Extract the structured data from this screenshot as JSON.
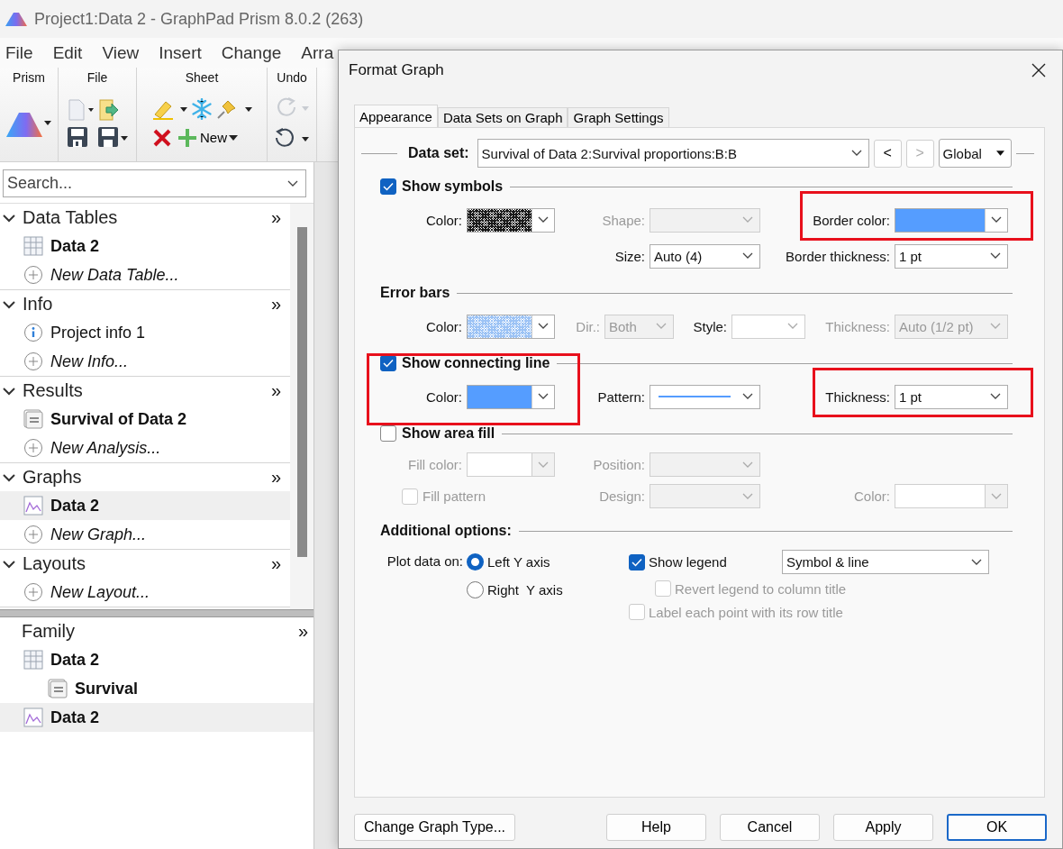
{
  "window": {
    "title": "Project1:Data 2 - GraphPad Prism 8.0.2 (263)"
  },
  "menu": [
    "File",
    "Edit",
    "View",
    "Insert",
    "Change",
    "Arra"
  ],
  "ribbon": {
    "groups": [
      {
        "label": "Prism",
        "kind": "prism"
      },
      {
        "label": "File",
        "kind": "file"
      },
      {
        "label": "Sheet",
        "kind": "sheet",
        "button": "New"
      },
      {
        "label": "Undo",
        "kind": "undo"
      }
    ]
  },
  "search": {
    "placeholder": "Search..."
  },
  "navigator": {
    "sections": [
      {
        "title": "Data Tables",
        "more": "»",
        "expanded": true,
        "items": [
          {
            "label": "Data 2",
            "kind": "table",
            "selected": false
          },
          {
            "label": "New Data Table...",
            "kind": "new",
            "selected": false
          }
        ]
      },
      {
        "title": "Info",
        "more": "»",
        "expanded": true,
        "items": [
          {
            "label": "Project info 1",
            "kind": "info",
            "selected": false
          },
          {
            "label": "New Info...",
            "kind": "new",
            "selected": false
          }
        ]
      },
      {
        "title": "Results",
        "more": "»",
        "expanded": true,
        "items": [
          {
            "label": "Survival of Data 2",
            "kind": "results",
            "selected": false
          },
          {
            "label": "New Analysis...",
            "kind": "new",
            "selected": false
          }
        ]
      },
      {
        "title": "Graphs",
        "more": "»",
        "expanded": true,
        "items": [
          {
            "label": "Data 2",
            "kind": "graph",
            "selected": true
          },
          {
            "label": "New Graph...",
            "kind": "new",
            "selected": false
          }
        ]
      },
      {
        "title": "Layouts",
        "more": "»",
        "expanded": true,
        "items": [
          {
            "label": "New Layout...",
            "kind": "new",
            "selected": false
          }
        ]
      }
    ]
  },
  "family": {
    "title": "Family",
    "more": "»",
    "items": [
      {
        "label": "Data 2",
        "kind": "table",
        "selected": false,
        "children": [
          {
            "label": "Survival",
            "kind": "results",
            "selected": false
          }
        ]
      },
      {
        "label": "Data 2",
        "kind": "graph",
        "selected": true
      }
    ]
  },
  "dialog": {
    "title": "Format Graph",
    "tabs": [
      {
        "label": "Appearance",
        "selected": true
      },
      {
        "label": "Data Sets on Graph",
        "selected": false
      },
      {
        "label": "Graph Settings",
        "selected": false
      }
    ],
    "data_set": {
      "label": "Data set:",
      "value": "Survival of Data 2:Survival proportions:B:B",
      "prev": {
        "label": "<",
        "disabled": false
      },
      "next": {
        "label": ">",
        "disabled": true
      },
      "scope": "Global"
    },
    "sections": [
      {
        "kind": "check",
        "title": "Show symbols",
        "checked": true,
        "highlighted": false,
        "rows": [
          [
            {
              "label": "Color:",
              "kind": "swatch",
              "color": "#1a1a1a",
              "hatched": true,
              "disabled": false
            },
            {
              "label": "Shape:",
              "kind": "select",
              "disabled": true
            },
            {
              "label": "Border color:",
              "kind": "swatch",
              "color": "#559dff",
              "hatched": false,
              "disabled": false,
              "highlighted": true
            }
          ],
          [
            null,
            {
              "label": "Size:",
              "kind": "select",
              "value": "Auto (4)",
              "disabled": false
            },
            {
              "label": "Border thickness:",
              "kind": "select",
              "value": "1 pt",
              "disabled": false
            }
          ]
        ]
      },
      {
        "kind": "plain",
        "title": "Error bars",
        "highlighted": false,
        "rows": [
          [
            {
              "label": "Color:",
              "kind": "swatch",
              "color": "#9cc3f5",
              "hatched": true,
              "disabled": false
            },
            {
              "label": "Dir.:",
              "kind": "select",
              "value": "Both",
              "disabled": true
            },
            {
              "label": "Style:",
              "kind": "select",
              "disabled": false
            },
            {
              "label": "Thickness:",
              "kind": "select",
              "value": "Auto (1/2 pt)",
              "disabled": true
            }
          ]
        ]
      },
      {
        "kind": "check",
        "title": "Show connecting line",
        "checked": true,
        "highlighted": true,
        "rows": [
          [
            {
              "label": "Color:",
              "kind": "swatch",
              "color": "#559dff",
              "hatched": false,
              "disabled": false
            },
            {
              "label": "Pattern:",
              "kind": "line",
              "color": "#559dff",
              "disabled": false
            },
            {
              "label": "Thickness:",
              "kind": "select",
              "value": "1 pt",
              "disabled": false,
              "highlighted": true
            }
          ]
        ]
      },
      {
        "kind": "check",
        "title": "Show area fill",
        "checked": false,
        "highlighted": false,
        "rows": [
          [
            {
              "label": "Fill color:",
              "kind": "swatch",
              "disabled": true
            },
            {
              "label": "Position:",
              "kind": "select",
              "disabled": true
            },
            null
          ],
          [
            {
              "label": "Fill pattern",
              "kind": "checkbox",
              "checked": false,
              "disabled": true
            },
            {
              "label": "Design:",
              "kind": "select",
              "disabled": true
            },
            {
              "label": "Color:",
              "kind": "swatch",
              "disabled": true
            }
          ]
        ]
      }
    ],
    "additional": {
      "title": "Additional options:",
      "plot_label": "Plot data on:",
      "axes": [
        {
          "label": "Left Y axis",
          "selected": true
        },
        {
          "label": "Right  Y axis",
          "selected": false
        }
      ],
      "legend": {
        "label": "Show legend",
        "checked": true,
        "disabled": false,
        "style": "Symbol & line",
        "children": [
          {
            "label": "Revert legend to column title",
            "checked": false,
            "disabled": true
          }
        ]
      },
      "label_points": {
        "label": "Label each point with its row title",
        "checked": false,
        "disabled": true
      }
    },
    "buttons": [
      {
        "label": "Change Graph Type...",
        "default": false
      },
      {
        "label": "Help",
        "default": false
      },
      {
        "label": "Cancel",
        "default": false
      },
      {
        "label": "Apply",
        "default": false
      },
      {
        "label": "OK",
        "default": true
      }
    ]
  }
}
